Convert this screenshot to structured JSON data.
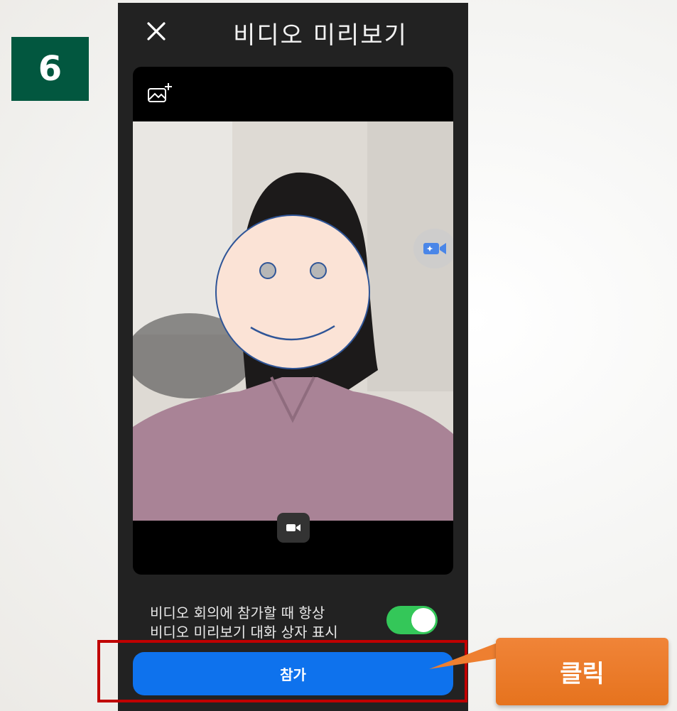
{
  "step": {
    "number": "6"
  },
  "header": {
    "title": "비디오 미리보기",
    "close_icon": "close-icon"
  },
  "preview": {
    "background_icon": "add-image-icon",
    "effects_icon": "video-effects-icon",
    "camera_icon": "video-camera-icon"
  },
  "settings": {
    "option_line1": "비디오 회의에 참가할 때 항상",
    "option_line2": "비디오 미리보기 대화 상자 표시",
    "toggle_on": true
  },
  "actions": {
    "join_label": "참가"
  },
  "annotation": {
    "click_label": "클릭"
  },
  "colors": {
    "badge": "#02573f",
    "join_button": "#0e72ed",
    "toggle": "#34c759",
    "highlight": "#c00000",
    "callout": "#ee7f30"
  }
}
